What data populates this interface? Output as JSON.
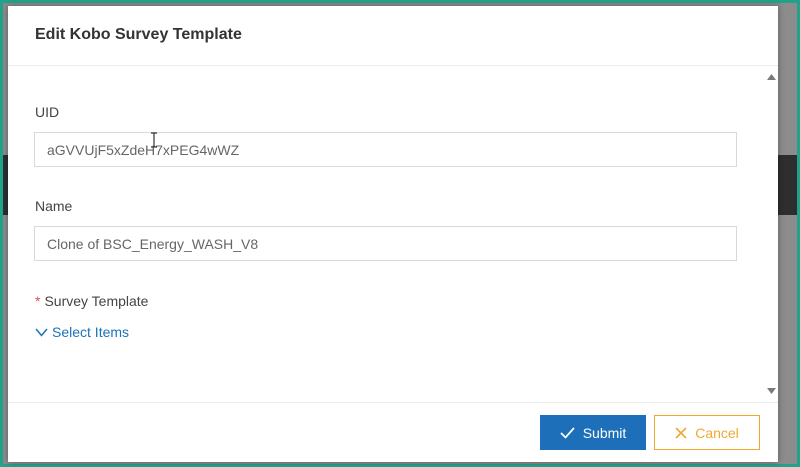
{
  "modal": {
    "title": "Edit Kobo Survey Template"
  },
  "form": {
    "uid": {
      "label": "UID",
      "value": "aGVVUjF5xZdeH7xPEG4wWZ"
    },
    "name": {
      "label": "Name",
      "value": "Clone of BSC_Energy_WASH_V8"
    },
    "survey_template": {
      "required_mark": "*",
      "label": "Survey Template",
      "select_label": "Select Items"
    }
  },
  "footer": {
    "submit_label": "Submit",
    "cancel_label": "Cancel"
  },
  "colors": {
    "primary": "#1c6fb8",
    "cancel": "#f0a830",
    "link": "#1a73b9",
    "required": "#d9534f",
    "frame": "#21a38a"
  },
  "icons": {
    "submit": "check-icon",
    "cancel": "close-icon",
    "select": "chevron-down-icon"
  }
}
